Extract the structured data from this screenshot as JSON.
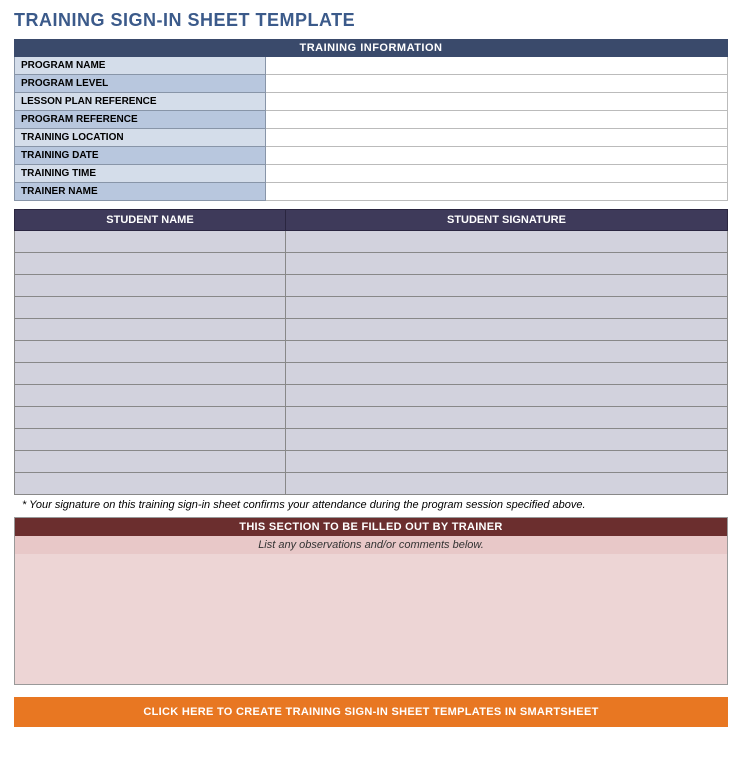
{
  "title": "TRAINING SIGN-IN SHEET TEMPLATE",
  "info": {
    "header": "TRAINING INFORMATION",
    "fields": [
      {
        "label": "PROGRAM NAME",
        "value": "",
        "light": true
      },
      {
        "label": "PROGRAM LEVEL",
        "value": "",
        "light": false
      },
      {
        "label": "LESSON PLAN REFERENCE",
        "value": "",
        "light": true
      },
      {
        "label": "PROGRAM REFERENCE",
        "value": "",
        "light": false
      },
      {
        "label": "TRAINING LOCATION",
        "value": "",
        "light": true
      },
      {
        "label": "TRAINING DATE",
        "value": "",
        "light": false
      },
      {
        "label": "TRAINING TIME",
        "value": "",
        "light": true
      },
      {
        "label": "TRAINER NAME",
        "value": "",
        "light": false
      }
    ]
  },
  "students": {
    "headers": {
      "name": "STUDENT NAME",
      "signature": "STUDENT SIGNATURE"
    },
    "rows": [
      {
        "name": "",
        "signature": ""
      },
      {
        "name": "",
        "signature": ""
      },
      {
        "name": "",
        "signature": ""
      },
      {
        "name": "",
        "signature": ""
      },
      {
        "name": "",
        "signature": ""
      },
      {
        "name": "",
        "signature": ""
      },
      {
        "name": "",
        "signature": ""
      },
      {
        "name": "",
        "signature": ""
      },
      {
        "name": "",
        "signature": ""
      },
      {
        "name": "",
        "signature": ""
      },
      {
        "name": "",
        "signature": ""
      },
      {
        "name": "",
        "signature": ""
      }
    ]
  },
  "disclaimer": "* Your signature on this training sign-in sheet confirms your attendance during the program session specified above.",
  "trainer": {
    "header": "THIS SECTION TO BE FILLED OUT BY TRAINER",
    "hint": "List any observations and/or comments below."
  },
  "cta": "CLICK HERE TO CREATE TRAINING SIGN-IN SHEET TEMPLATES IN SMARTSHEET"
}
